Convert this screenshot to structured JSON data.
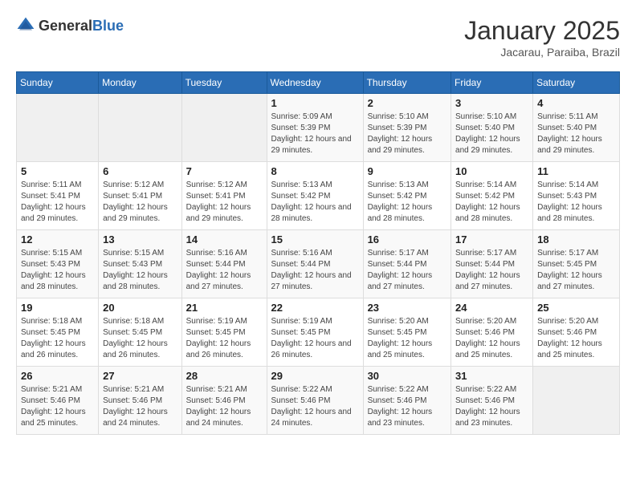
{
  "header": {
    "logo_general": "General",
    "logo_blue": "Blue",
    "month": "January 2025",
    "location": "Jacarau, Paraiba, Brazil"
  },
  "days_of_week": [
    "Sunday",
    "Monday",
    "Tuesday",
    "Wednesday",
    "Thursday",
    "Friday",
    "Saturday"
  ],
  "weeks": [
    [
      {
        "day": "",
        "info": ""
      },
      {
        "day": "",
        "info": ""
      },
      {
        "day": "",
        "info": ""
      },
      {
        "day": "1",
        "info": "Sunrise: 5:09 AM\nSunset: 5:39 PM\nDaylight: 12 hours and 29 minutes."
      },
      {
        "day": "2",
        "info": "Sunrise: 5:10 AM\nSunset: 5:39 PM\nDaylight: 12 hours and 29 minutes."
      },
      {
        "day": "3",
        "info": "Sunrise: 5:10 AM\nSunset: 5:40 PM\nDaylight: 12 hours and 29 minutes."
      },
      {
        "day": "4",
        "info": "Sunrise: 5:11 AM\nSunset: 5:40 PM\nDaylight: 12 hours and 29 minutes."
      }
    ],
    [
      {
        "day": "5",
        "info": "Sunrise: 5:11 AM\nSunset: 5:41 PM\nDaylight: 12 hours and 29 minutes."
      },
      {
        "day": "6",
        "info": "Sunrise: 5:12 AM\nSunset: 5:41 PM\nDaylight: 12 hours and 29 minutes."
      },
      {
        "day": "7",
        "info": "Sunrise: 5:12 AM\nSunset: 5:41 PM\nDaylight: 12 hours and 29 minutes."
      },
      {
        "day": "8",
        "info": "Sunrise: 5:13 AM\nSunset: 5:42 PM\nDaylight: 12 hours and 28 minutes."
      },
      {
        "day": "9",
        "info": "Sunrise: 5:13 AM\nSunset: 5:42 PM\nDaylight: 12 hours and 28 minutes."
      },
      {
        "day": "10",
        "info": "Sunrise: 5:14 AM\nSunset: 5:42 PM\nDaylight: 12 hours and 28 minutes."
      },
      {
        "day": "11",
        "info": "Sunrise: 5:14 AM\nSunset: 5:43 PM\nDaylight: 12 hours and 28 minutes."
      }
    ],
    [
      {
        "day": "12",
        "info": "Sunrise: 5:15 AM\nSunset: 5:43 PM\nDaylight: 12 hours and 28 minutes."
      },
      {
        "day": "13",
        "info": "Sunrise: 5:15 AM\nSunset: 5:43 PM\nDaylight: 12 hours and 28 minutes."
      },
      {
        "day": "14",
        "info": "Sunrise: 5:16 AM\nSunset: 5:44 PM\nDaylight: 12 hours and 27 minutes."
      },
      {
        "day": "15",
        "info": "Sunrise: 5:16 AM\nSunset: 5:44 PM\nDaylight: 12 hours and 27 minutes."
      },
      {
        "day": "16",
        "info": "Sunrise: 5:17 AM\nSunset: 5:44 PM\nDaylight: 12 hours and 27 minutes."
      },
      {
        "day": "17",
        "info": "Sunrise: 5:17 AM\nSunset: 5:44 PM\nDaylight: 12 hours and 27 minutes."
      },
      {
        "day": "18",
        "info": "Sunrise: 5:17 AM\nSunset: 5:45 PM\nDaylight: 12 hours and 27 minutes."
      }
    ],
    [
      {
        "day": "19",
        "info": "Sunrise: 5:18 AM\nSunset: 5:45 PM\nDaylight: 12 hours and 26 minutes."
      },
      {
        "day": "20",
        "info": "Sunrise: 5:18 AM\nSunset: 5:45 PM\nDaylight: 12 hours and 26 minutes."
      },
      {
        "day": "21",
        "info": "Sunrise: 5:19 AM\nSunset: 5:45 PM\nDaylight: 12 hours and 26 minutes."
      },
      {
        "day": "22",
        "info": "Sunrise: 5:19 AM\nSunset: 5:45 PM\nDaylight: 12 hours and 26 minutes."
      },
      {
        "day": "23",
        "info": "Sunrise: 5:20 AM\nSunset: 5:45 PM\nDaylight: 12 hours and 25 minutes."
      },
      {
        "day": "24",
        "info": "Sunrise: 5:20 AM\nSunset: 5:46 PM\nDaylight: 12 hours and 25 minutes."
      },
      {
        "day": "25",
        "info": "Sunrise: 5:20 AM\nSunset: 5:46 PM\nDaylight: 12 hours and 25 minutes."
      }
    ],
    [
      {
        "day": "26",
        "info": "Sunrise: 5:21 AM\nSunset: 5:46 PM\nDaylight: 12 hours and 25 minutes."
      },
      {
        "day": "27",
        "info": "Sunrise: 5:21 AM\nSunset: 5:46 PM\nDaylight: 12 hours and 24 minutes."
      },
      {
        "day": "28",
        "info": "Sunrise: 5:21 AM\nSunset: 5:46 PM\nDaylight: 12 hours and 24 minutes."
      },
      {
        "day": "29",
        "info": "Sunrise: 5:22 AM\nSunset: 5:46 PM\nDaylight: 12 hours and 24 minutes."
      },
      {
        "day": "30",
        "info": "Sunrise: 5:22 AM\nSunset: 5:46 PM\nDaylight: 12 hours and 23 minutes."
      },
      {
        "day": "31",
        "info": "Sunrise: 5:22 AM\nSunset: 5:46 PM\nDaylight: 12 hours and 23 minutes."
      },
      {
        "day": "",
        "info": ""
      }
    ]
  ]
}
